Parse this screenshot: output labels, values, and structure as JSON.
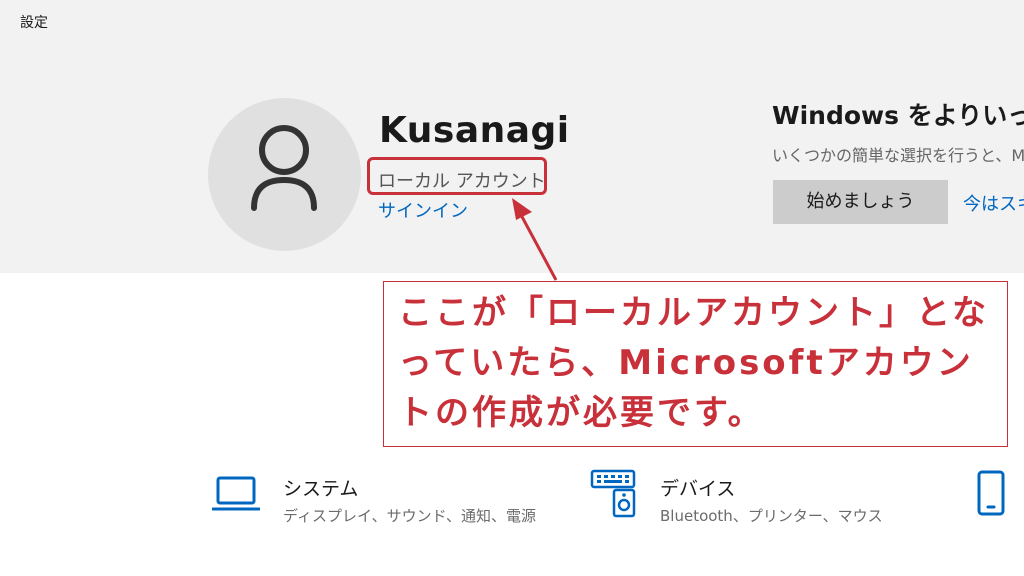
{
  "window": {
    "title": "設定"
  },
  "account": {
    "name": "Kusanagi",
    "type": "ローカル アカウント",
    "signin_link": "サインイン"
  },
  "promo": {
    "title": "Windows をよりいっそ",
    "description": "いくつかの簡単な選択を行うと、M",
    "start_button": "始めましょう",
    "skip_link": "今はスキ"
  },
  "annotation": {
    "text": "ここが「ローカルアカウント」となっていたら、Microsoftアカウントの作成が必要です。",
    "color": "#c8303a"
  },
  "settings": [
    {
      "icon": "laptop-icon",
      "title": "システム",
      "description": "ディスプレイ、サウンド、通知、電源"
    },
    {
      "icon": "keyboard-speaker-icon",
      "title": "デバイス",
      "description": "Bluetooth、プリンター、マウス"
    },
    {
      "icon": "phone-icon",
      "title": "",
      "description": ""
    }
  ],
  "colors": {
    "accent": "#0067c0",
    "header_background": "#f2f2f2",
    "avatar_background": "#e0e0e0",
    "button_background": "#cccccc",
    "annotation": "#c8303a"
  }
}
